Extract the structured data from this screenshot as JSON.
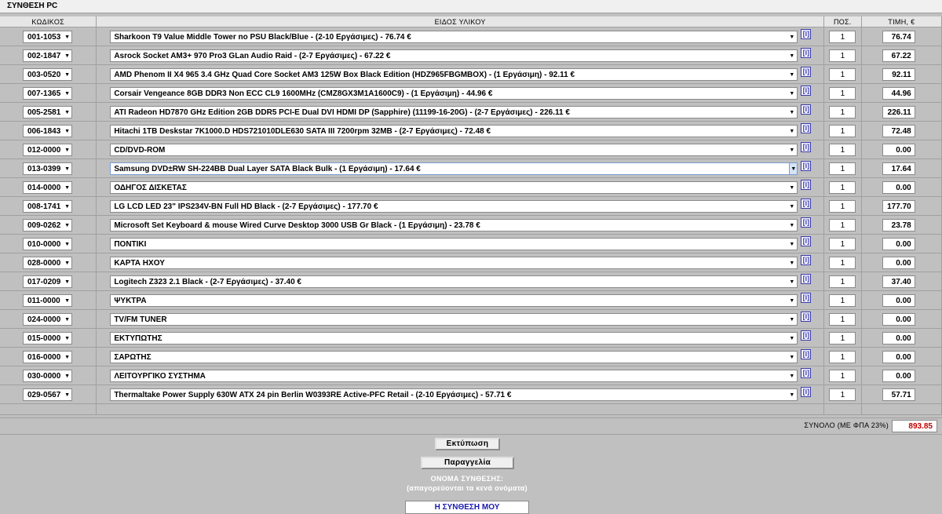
{
  "title": "ΣΥΝΘΕΣΗ PC",
  "columns": {
    "code": "ΚΩΔΙΚΟΣ",
    "item": "ΕΙΔΟΣ ΥΛΙΚΟΥ",
    "qty": "ΠΟΣ.",
    "price": "ΤΙΜΗ, €"
  },
  "info_label": "[i]",
  "rows": [
    {
      "code": "001-1053",
      "desc": "Sharkoon T9 Value Middle Tower no PSU Black/Blue - (2-10 Εργάσιμες) - 76.74 €",
      "qty": "1",
      "price": "76.74"
    },
    {
      "code": "002-1847",
      "desc": "Asrock Socket AM3+ 970 Pro3 GLan Audio Raid - (2-7 Εργάσιμες) - 67.22 €",
      "qty": "1",
      "price": "67.22"
    },
    {
      "code": "003-0520",
      "desc": "AMD Phenom II X4 965 3.4 GHz Quad Core Socket AM3 125W Box Black Edition (HDZ965FBGMBOX) - (1 Εργάσιμη) - 92.11 €",
      "qty": "1",
      "price": "92.11"
    },
    {
      "code": "007-1365",
      "desc": "Corsair Vengeance 8GB DDR3 Non ECC CL9 1600MHz (CMZ8GX3M1A1600C9) - (1 Εργάσιμη) - 44.96 €",
      "qty": "1",
      "price": "44.96"
    },
    {
      "code": "005-2581",
      "desc": "ATI Radeon HD7870 GHz Edition 2GB DDR5 PCI-E Dual DVI HDMI DP (Sapphire) (11199-16-20G) - (2-7 Εργάσιμες) - 226.11 €",
      "qty": "1",
      "price": "226.11"
    },
    {
      "code": "006-1843",
      "desc": "Hitachi 1TB Deskstar 7K1000.D HDS721010DLE630 SATA III 7200rpm 32MB - (2-7 Εργάσιμες) - 72.48 €",
      "qty": "1",
      "price": "72.48"
    },
    {
      "code": "012-0000",
      "desc": "CD/DVD-ROM",
      "qty": "1",
      "price": "0.00"
    },
    {
      "code": "013-0399",
      "desc": "Samsung DVD±RW SH-224BB Dual Layer SATA Black Bulk - (1 Εργάσιμη) - 17.64 €",
      "qty": "1",
      "price": "17.64",
      "selected": true
    },
    {
      "code": "014-0000",
      "desc": "ΟΔΗΓΟΣ ΔΙΣΚΕΤΑΣ",
      "qty": "1",
      "price": "0.00"
    },
    {
      "code": "008-1741",
      "desc": "LG LCD LED 23\" IPS234V-BN Full HD Black - (2-7 Εργάσιμες) - 177.70 €",
      "qty": "1",
      "price": "177.70"
    },
    {
      "code": "009-0262",
      "desc": "Microsoft Set Keyboard & mouse Wired Curve Desktop 3000 USB Gr Black - (1 Εργάσιμη) - 23.78 €",
      "qty": "1",
      "price": "23.78"
    },
    {
      "code": "010-0000",
      "desc": "ΠΟΝΤΙΚΙ",
      "qty": "1",
      "price": "0.00"
    },
    {
      "code": "028-0000",
      "desc": "ΚΑΡΤΑ ΗΧΟΥ",
      "qty": "1",
      "price": "0.00"
    },
    {
      "code": "017-0209",
      "desc": "Logitech Z323 2.1 Black - (2-7 Εργάσιμες) - 37.40 €",
      "qty": "1",
      "price": "37.40"
    },
    {
      "code": "011-0000",
      "desc": "ΨΥΚΤΡΑ",
      "qty": "1",
      "price": "0.00"
    },
    {
      "code": "024-0000",
      "desc": "TV/FM TUNER",
      "qty": "1",
      "price": "0.00"
    },
    {
      "code": "015-0000",
      "desc": "ΕΚΤΥΠΩΤΗΣ",
      "qty": "1",
      "price": "0.00"
    },
    {
      "code": "016-0000",
      "desc": "ΣΑΡΩΤΗΣ",
      "qty": "1",
      "price": "0.00"
    },
    {
      "code": "030-0000",
      "desc": "ΛΕΙΤΟΥΡΓΙΚΟ ΣΥΣΤΗΜΑ",
      "qty": "1",
      "price": "0.00"
    },
    {
      "code": "029-0567",
      "desc": "Thermaltake Power Supply 630W ATX 24 pin Berlin W0393RE Active-PFC Retail - (2-10 Εργάσιμες) - 57.71 €",
      "qty": "1",
      "price": "57.71"
    }
  ],
  "total": {
    "label": "ΣΥΝΟΛΟ (ΜΕ ΦΠΑ 23%)",
    "value": "893.85"
  },
  "buttons": {
    "print": "Εκτύπωση",
    "order": "Παραγγελία"
  },
  "name_section": {
    "label": "ΟΝΟΜΑ ΣΥΝΘΕΣΗΣ:",
    "hint": "(απαγορεύονται τα κενά ονόματα)",
    "value": "Η ΣΥΝΘΕΣΗ ΜΟΥ"
  },
  "colors": {
    "total_value": "#c00000",
    "name_text": "#1a1ab0",
    "background": "#c0c0c0"
  }
}
